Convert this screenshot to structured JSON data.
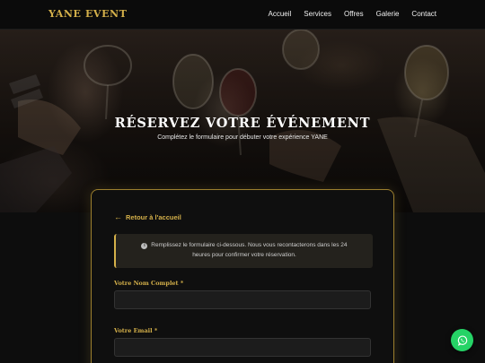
{
  "brand": "YANE EVENT",
  "nav": {
    "items": [
      {
        "label": "Accueil"
      },
      {
        "label": "Services"
      },
      {
        "label": "Offres"
      },
      {
        "label": "Galerie"
      },
      {
        "label": "Contact"
      }
    ]
  },
  "hero": {
    "title": "RÉSERVEZ VOTRE ÉVÉNEMENT",
    "subtitle": "Complétez le formulaire pour débuter votre expérience YANE"
  },
  "form": {
    "back_label": "Retour à l'accueil",
    "info_line1": "Remplissez le formulaire ci-dessous. Nous vous recontacterons dans les 24",
    "info_line2": "heures pour confirmer votre réservation.",
    "fields": [
      {
        "label": "Votre Nom Complet *",
        "value": ""
      },
      {
        "label": "Votre Email *",
        "value": ""
      }
    ]
  },
  "colors": {
    "accent": "#d4b04a",
    "whatsapp": "#25d366",
    "background": "#0d0d0d"
  },
  "icons": {
    "back": "arrow-left-icon",
    "info": "info-circle-icon",
    "whatsapp": "whatsapp-icon"
  }
}
